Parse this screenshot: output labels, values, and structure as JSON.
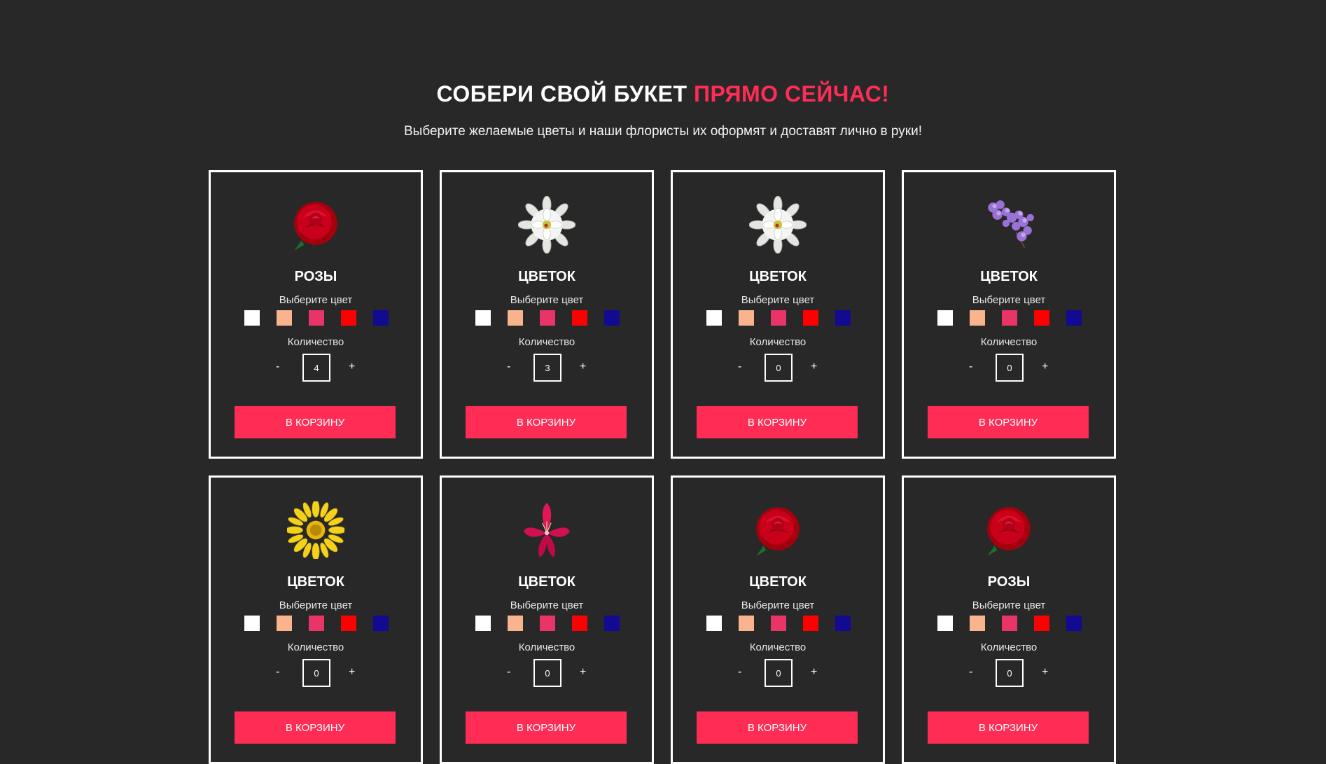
{
  "header": {
    "title_main": "СОБЕРИ СВОЙ БУКЕТ ",
    "title_accent": "ПРЯМО СЕЙЧАС!",
    "subtitle": "Выберите желаемые цветы и наши флористы их оформят и доставят лично в руки!"
  },
  "colors": {
    "background": "#282828",
    "accent": "#ff2d55",
    "swatches": [
      "#ffffff",
      "#f9b48e",
      "#e83467",
      "#ff0000",
      "#120b91"
    ]
  },
  "cards": [
    {
      "title": "РОЗЫ",
      "flower": "red-rose-icon",
      "color_label": "Выберите цвет",
      "qty_label": "Количество",
      "qty": "4",
      "minus": "-",
      "plus": "+",
      "button": "В КОРЗИНУ"
    },
    {
      "title": "ЦВЕТОК",
      "flower": "white-dahlia-icon",
      "color_label": "Выберите цвет",
      "qty_label": "Количество",
      "qty": "3",
      "minus": "-",
      "plus": "+",
      "button": "В КОРЗИНУ"
    },
    {
      "title": "ЦВЕТОК",
      "flower": "white-dahlia-icon",
      "color_label": "Выберите цвет",
      "qty_label": "Количество",
      "qty": "0",
      "minus": "-",
      "plus": "+",
      "button": "В КОРЗИНУ"
    },
    {
      "title": "ЦВЕТОК",
      "flower": "lilac-icon",
      "color_label": "Выберите цвет",
      "qty_label": "Количество",
      "qty": "0",
      "minus": "-",
      "plus": "+",
      "button": "В КОРЗИНУ"
    },
    {
      "title": "ЦВЕТОК",
      "flower": "yellow-gerbera-icon",
      "color_label": "Выберите цвет",
      "qty_label": "Количество",
      "qty": "0",
      "minus": "-",
      "plus": "+",
      "button": "В КОРЗИНУ"
    },
    {
      "title": "ЦВЕТОК",
      "flower": "pink-alstroemeria-icon",
      "color_label": "Выберите цвет",
      "qty_label": "Количество",
      "qty": "0",
      "minus": "-",
      "plus": "+",
      "button": "В КОРЗИНУ"
    },
    {
      "title": "ЦВЕТОК",
      "flower": "red-rose-icon",
      "color_label": "Выберите цвет",
      "qty_label": "Количество",
      "qty": "0",
      "minus": "-",
      "plus": "+",
      "button": "В КОРЗИНУ"
    },
    {
      "title": "РОЗЫ",
      "flower": "red-rose-icon",
      "color_label": "Выберите цвет",
      "qty_label": "Количество",
      "qty": "0",
      "minus": "-",
      "plus": "+",
      "button": "В КОРЗИНУ"
    }
  ]
}
